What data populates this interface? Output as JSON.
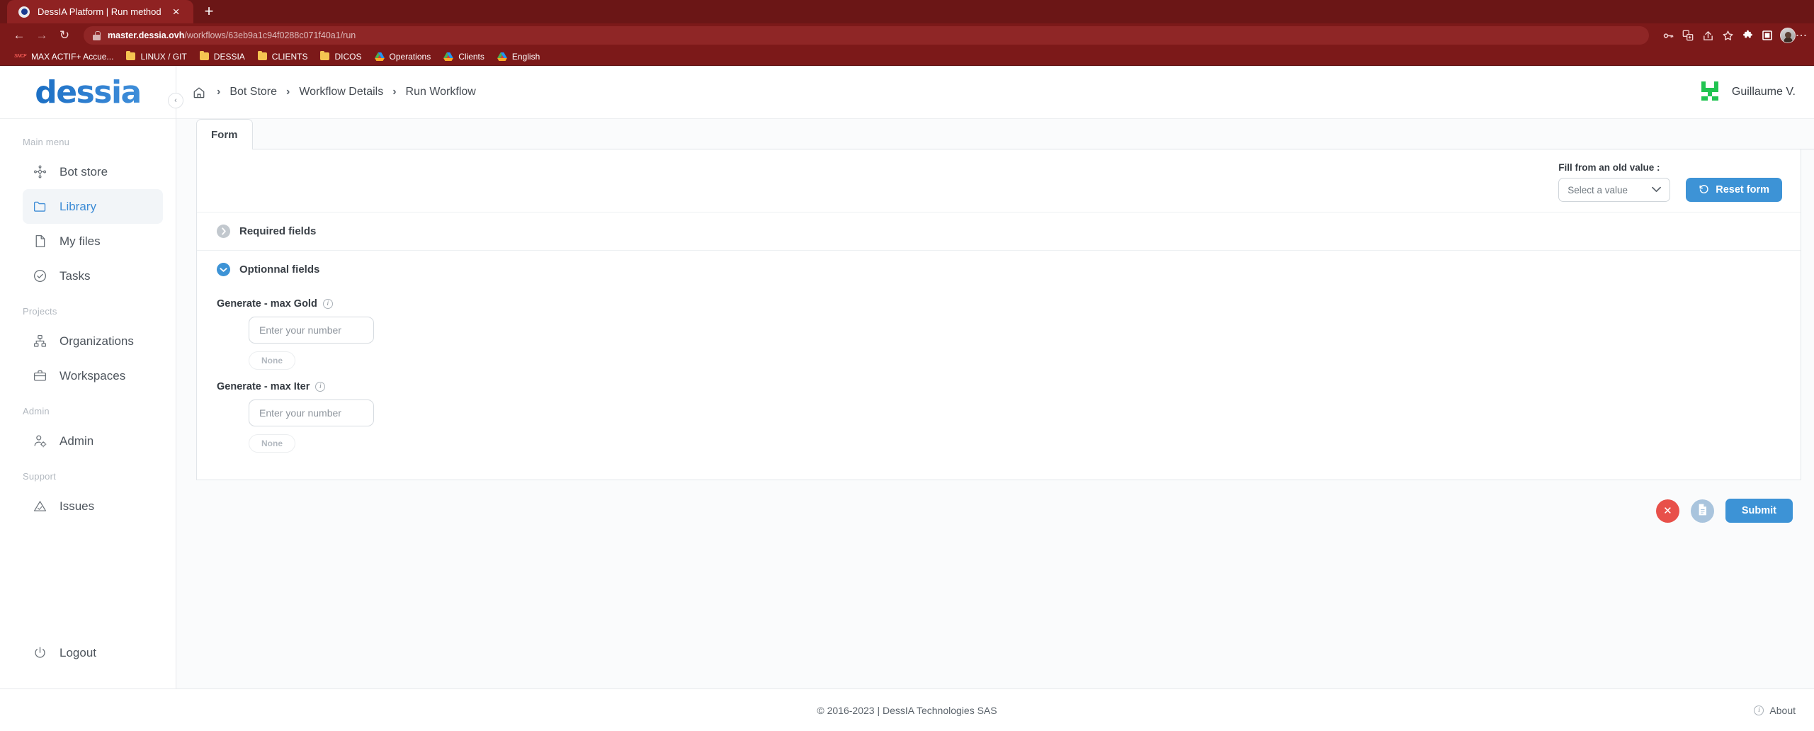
{
  "browser": {
    "tab": {
      "title": "DessIA Platform | Run method",
      "favicon": "globe-icon",
      "close": "×"
    },
    "new_tab": "+",
    "nav": {
      "back": "←",
      "forward": "→",
      "reload": "↻"
    },
    "omnibox": {
      "secure_icon": "lock-icon",
      "url_domain": "master.dessia.ovh",
      "url_path": "/workflows/63eb9a1c94f0288c071f40a1/run",
      "url_full": "master.dessia.ovh/workflows/63eb9a1c94f0288c071f40a1/run"
    },
    "toolbar_icons": [
      {
        "name": "password-key-icon",
        "glyph": "⚷"
      },
      {
        "name": "translate-icon",
        "glyph": "文"
      },
      {
        "name": "share-icon",
        "glyph": "➦"
      },
      {
        "name": "bookmark-star-icon",
        "glyph": "☆"
      },
      {
        "name": "extensions-puzzle-icon",
        "glyph": "❖"
      },
      {
        "name": "side-panel-icon",
        "glyph": "▣"
      }
    ],
    "menu_glyph": "⋮",
    "bookmarks": [
      {
        "label": "MAX ACTIF+ Accue...",
        "icon": "sncf-icon"
      },
      {
        "label": "LINUX / GIT",
        "icon": "folder-icon"
      },
      {
        "label": "DESSIA",
        "icon": "folder-icon"
      },
      {
        "label": "CLIENTS",
        "icon": "folder-icon"
      },
      {
        "label": "DICOS",
        "icon": "folder-icon"
      },
      {
        "label": "Operations",
        "icon": "google-drive-icon"
      },
      {
        "label": "Clients",
        "icon": "google-drive-icon"
      },
      {
        "label": "English",
        "icon": "google-drive-icon"
      }
    ]
  },
  "sidebar": {
    "logo": "dessia",
    "collapse_glyph": "‹",
    "sections": [
      {
        "label": "Main menu",
        "items": [
          {
            "label": "Bot store",
            "icon": "bot-store-icon",
            "active": false
          },
          {
            "label": "Library",
            "icon": "folder-icon",
            "active": true
          },
          {
            "label": "My files",
            "icon": "file-icon",
            "active": false
          },
          {
            "label": "Tasks",
            "icon": "check-circle-icon",
            "active": false
          }
        ]
      },
      {
        "label": "Projects",
        "items": [
          {
            "label": "Organizations",
            "icon": "sitemap-icon",
            "active": false
          },
          {
            "label": "Workspaces",
            "icon": "briefcase-icon",
            "active": false
          }
        ]
      },
      {
        "label": "Admin",
        "items": [
          {
            "label": "Admin",
            "icon": "user-cog-icon",
            "active": false
          }
        ]
      },
      {
        "label": "Support",
        "items": [
          {
            "label": "Issues",
            "icon": "warning-triangle-icon",
            "active": false
          }
        ]
      }
    ],
    "logout": {
      "label": "Logout",
      "icon": "power-icon"
    }
  },
  "topbar": {
    "breadcrumb": {
      "home_icon": "home-icon",
      "separator": "›",
      "items": [
        "Bot Store",
        "Workflow Details",
        "Run Workflow"
      ]
    },
    "user": {
      "name": "Guillaume V.",
      "avatar": "pixel-avatar-green"
    }
  },
  "tabs": [
    {
      "label": "Form",
      "active": true
    }
  ],
  "toolbar": {
    "fill_label": "Fill from an old value :",
    "select_placeholder": "Select a value",
    "select_chevron": "⌄",
    "reset_label": "Reset form",
    "reset_icon": "undo-icon"
  },
  "sections": [
    {
      "title": "Required fields",
      "expanded": false,
      "chevron": "›",
      "state_color": "#c2c8ce"
    },
    {
      "title": "Optionnal fields",
      "expanded": true,
      "chevron": "⌄",
      "state_color": "#3d93d6"
    }
  ],
  "fields": [
    {
      "label": "Generate - max Gold",
      "info_icon": "info-icon",
      "info_glyph": "i",
      "placeholder": "Enter your number",
      "value": "",
      "default_badge": "None"
    },
    {
      "label": "Generate - max Iter",
      "info_icon": "info-icon",
      "info_glyph": "i",
      "placeholder": "Enter your number",
      "value": "",
      "default_badge": "None"
    }
  ],
  "actions": {
    "cancel_glyph": "✕",
    "cancel_name": "cancel-button",
    "document_name": "document-button",
    "submit_label": "Submit"
  },
  "footer": {
    "copyright": "© 2016-2023 | DessIA Technologies SAS",
    "about_label": "About",
    "about_icon": "info-icon",
    "about_glyph": "i"
  },
  "colors": {
    "brand_blue": "#3d93d6",
    "browser_red": "#7c1919",
    "danger_red": "#e8504a",
    "avatar_green": "#21c451"
  }
}
